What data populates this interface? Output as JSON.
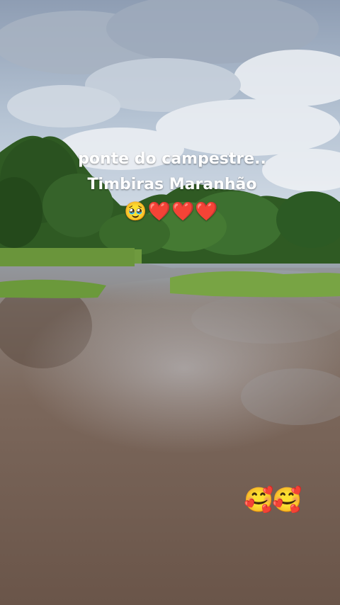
{
  "caption": {
    "line1": "ponte do campestre..",
    "line2": "Timbiras Maranhão",
    "emoji_line": "🥹❤️❤️❤️"
  },
  "sticker": {
    "emojis": "🥰🥰"
  },
  "colors": {
    "sky": "#b9c7d6",
    "vegetation": "#3c6a2c",
    "water": "#7a6659",
    "caption_text": "#ffffff"
  }
}
